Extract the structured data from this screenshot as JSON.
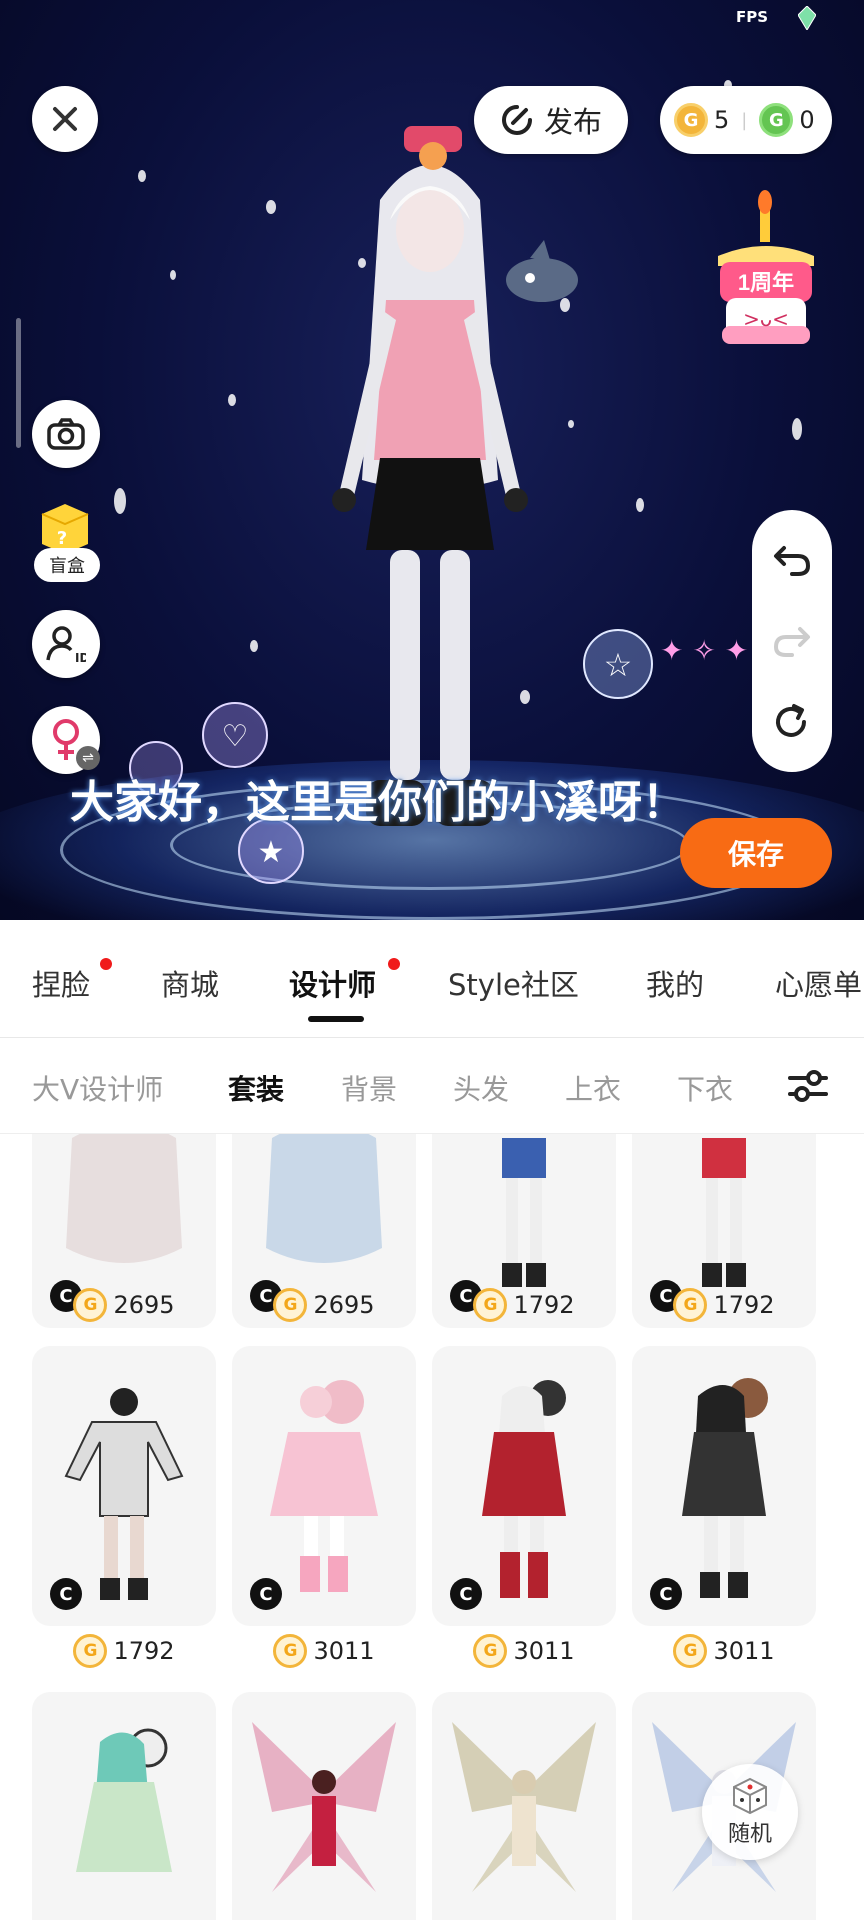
{
  "status": {
    "fps": "FPS"
  },
  "top": {
    "close_icon": "close-icon",
    "publish_label": "发布",
    "coins_gold": "5",
    "coins_green": "0",
    "coin_gold_glyph": "G",
    "coin_green_glyph": "G",
    "anniversary_text": "1周年"
  },
  "left_tools": {
    "blindbox_label": "盲盒",
    "blindbox_glyph": "?",
    "swap_glyph": "⇌"
  },
  "caption": "大家好，这里是你们的小溪呀！",
  "save_label": "保存",
  "main_tabs": [
    {
      "label": "捏脸",
      "dot": true
    },
    {
      "label": "商城",
      "dot": false
    },
    {
      "label": "设计师",
      "dot": true,
      "active": true
    },
    {
      "label": "Style社区",
      "dot": false
    },
    {
      "label": "我的",
      "dot": false
    },
    {
      "label": "心愿单",
      "dot": false
    }
  ],
  "sub_tabs": [
    {
      "label": "大V设计师"
    },
    {
      "label": "套装",
      "active": true
    },
    {
      "label": "背景"
    },
    {
      "label": "头发"
    },
    {
      "label": "上衣"
    },
    {
      "label": "下衣"
    }
  ],
  "items": [
    {
      "price": "2695",
      "badge": "C"
    },
    {
      "price": "2695",
      "badge": "C"
    },
    {
      "price": "1792",
      "badge": "C"
    },
    {
      "price": "1792",
      "badge": "C"
    },
    {
      "price": "1792",
      "badge": "C"
    },
    {
      "price": "3011",
      "badge": "C"
    },
    {
      "price": "3011",
      "badge": "C"
    },
    {
      "price": "3011",
      "badge": "C"
    },
    {
      "price": "",
      "badge": ""
    },
    {
      "price": "",
      "badge": ""
    },
    {
      "price": "",
      "badge": ""
    },
    {
      "price": "",
      "badge": ""
    }
  ],
  "price_coin_glyph": "G",
  "random_label": "随机",
  "colors": {
    "accent": "#f86b14",
    "coin": "#f3b53a",
    "coin_green": "#64c552",
    "dot": "#f01b1b"
  }
}
